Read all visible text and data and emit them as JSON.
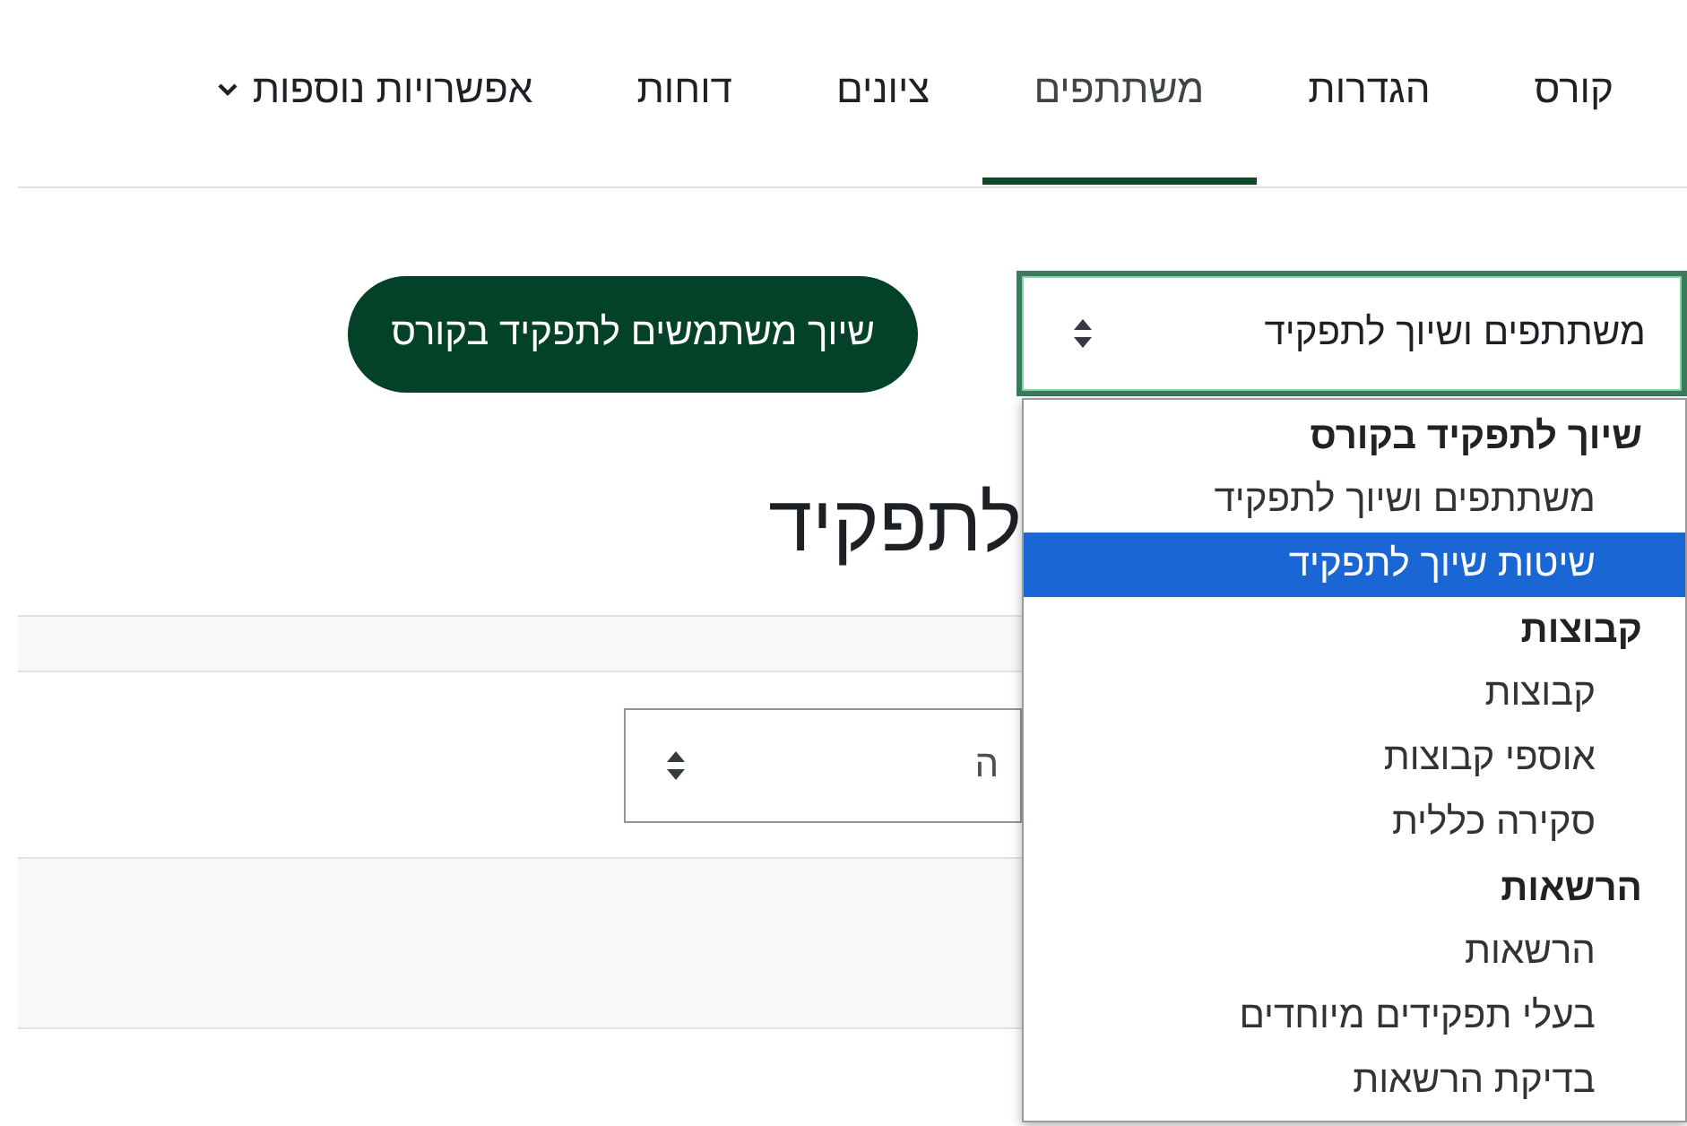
{
  "tabs": [
    {
      "label": "קורס",
      "selected": false
    },
    {
      "label": "הגדרות",
      "selected": false
    },
    {
      "label": "משתתפים",
      "selected": true
    },
    {
      "label": "ציונים",
      "selected": false
    },
    {
      "label": "דוחות",
      "selected": false
    }
  ],
  "more_menu": {
    "label": "אפשרויות נוספות"
  },
  "page_select": {
    "value": "משתתפים ושיוך לתפקיד",
    "open": true
  },
  "enrol_button": {
    "label": "שיוך משתמשים לתפקיד בקורס"
  },
  "heading": "לתפקיד",
  "filter_select": {
    "value": "ה"
  },
  "dropdown_groups": [
    {
      "label": "שיוך לתפקיד בקורס",
      "options": [
        {
          "label": "משתתפים ושיוך לתפקיד",
          "selected": false
        },
        {
          "label": "שיטות שיוך לתפקיד",
          "selected": true
        }
      ]
    },
    {
      "label": "קבוצות",
      "options": [
        {
          "label": "קבוצות",
          "selected": false
        },
        {
          "label": "אוספי קבוצות",
          "selected": false
        },
        {
          "label": "סקירה כללית",
          "selected": false
        }
      ]
    },
    {
      "label": "הרשאות",
      "options": [
        {
          "label": "הרשאות",
          "selected": false
        },
        {
          "label": "בעלי תפקידים מיוחדים",
          "selected": false
        },
        {
          "label": "בדיקת הרשאות",
          "selected": false
        }
      ]
    }
  ]
}
